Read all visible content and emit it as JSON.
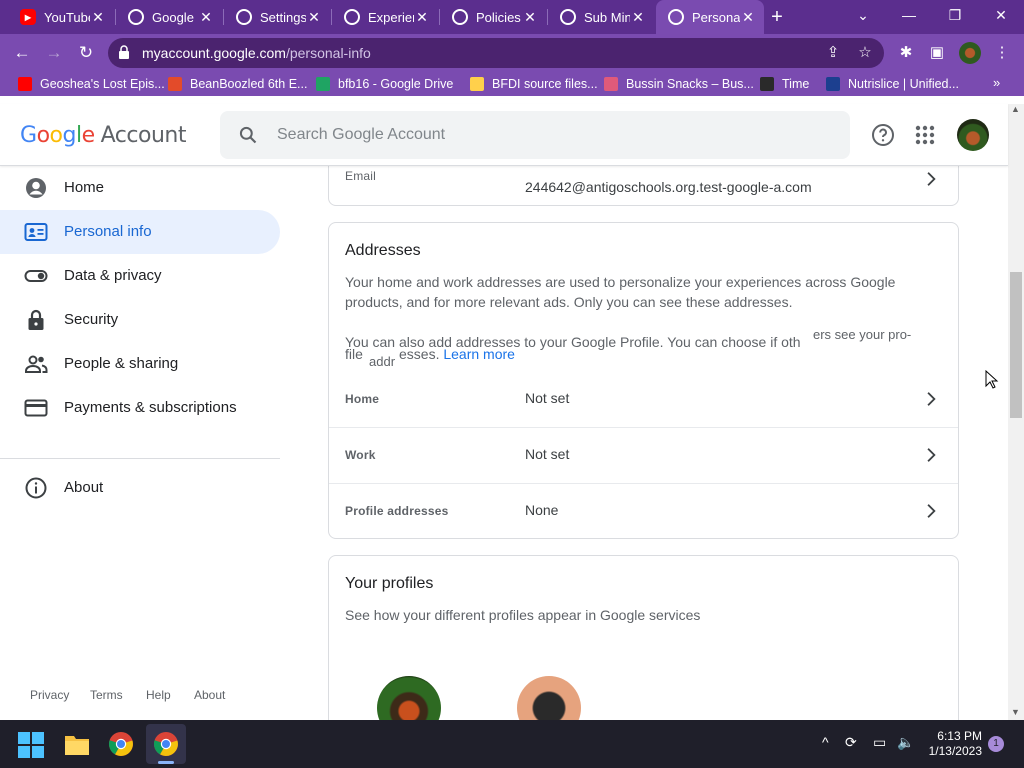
{
  "browser": {
    "tabs": [
      {
        "title": "YouTube",
        "icon": "youtube-icon",
        "active": false
      },
      {
        "title": "Google",
        "icon": "google-icon",
        "active": false
      },
      {
        "title": "Settings",
        "icon": "docs-icon",
        "active": false
      },
      {
        "title": "Experien",
        "icon": "google-icon",
        "active": false
      },
      {
        "title": "Policies",
        "icon": "globe-icon",
        "active": false
      },
      {
        "title": "Sub Min",
        "icon": "globe-icon",
        "active": false
      },
      {
        "title": "Persona",
        "icon": "google-icon",
        "active": true
      }
    ],
    "url_host": "myaccount.google.com",
    "url_path": "/personal-info",
    "bookmarks": [
      {
        "label": "Geoshea's Lost Epis...",
        "color": "#ff0000"
      },
      {
        "label": "BeanBoozled 6th E...",
        "color": "#e34b2a"
      },
      {
        "label": "bfb16 - Google Drive",
        "color": "#1fa463"
      },
      {
        "label": "BFDI source files...",
        "color": "#ffd04b"
      },
      {
        "label": "Bussin Snacks – Bus...",
        "color": "#e05a7a"
      },
      {
        "label": "Time",
        "color": "#2a2a2a"
      },
      {
        "label": "Nutrislice | Unified...",
        "color": "#1c3f8f"
      }
    ]
  },
  "header": {
    "logo_google": "Google",
    "logo_account": "Account",
    "search_placeholder": "Search Google Account"
  },
  "sidebar": {
    "items": [
      {
        "label": "Home",
        "icon": "person-circle-icon",
        "active": false
      },
      {
        "label": "Personal info",
        "icon": "id-card-icon",
        "active": true
      },
      {
        "label": "Data & privacy",
        "icon": "toggle-icon",
        "active": false
      },
      {
        "label": "Security",
        "icon": "lock-icon",
        "active": false
      },
      {
        "label": "People & sharing",
        "icon": "people-icon",
        "active": false
      },
      {
        "label": "Payments & subscriptions",
        "icon": "credit-card-icon",
        "active": false
      }
    ],
    "about": {
      "label": "About",
      "icon": "info-icon"
    },
    "footer": [
      "Privacy",
      "Terms",
      "Help",
      "About"
    ]
  },
  "email_card": {
    "label": "Email",
    "value": "244642@antigoschools.org.test-google-a.com"
  },
  "addresses": {
    "title": "Addresses",
    "description": "Your home and work addresses are used to personalize your experiences across Google products, and for more relevant ads. Only you can see these addresses.",
    "profile_note_a": "You can also add addresses to your Google Profile. You can choose if oth",
    "profile_note_b": "ers see your pro-",
    "profile_note_c": "file",
    "profile_note_d": "addr",
    "profile_note_e": "esses.",
    "learn_more": "Learn more",
    "rows": [
      {
        "label": "Home",
        "value": "Not set"
      },
      {
        "label": "Work",
        "value": "Not set"
      },
      {
        "label": "Profile addresses",
        "value": "None"
      }
    ]
  },
  "profiles": {
    "title": "Your profiles",
    "description": "See how your different profiles appear in Google services"
  },
  "taskbar": {
    "time": "6:13 PM",
    "date": "1/13/2023",
    "notifications": "1"
  }
}
